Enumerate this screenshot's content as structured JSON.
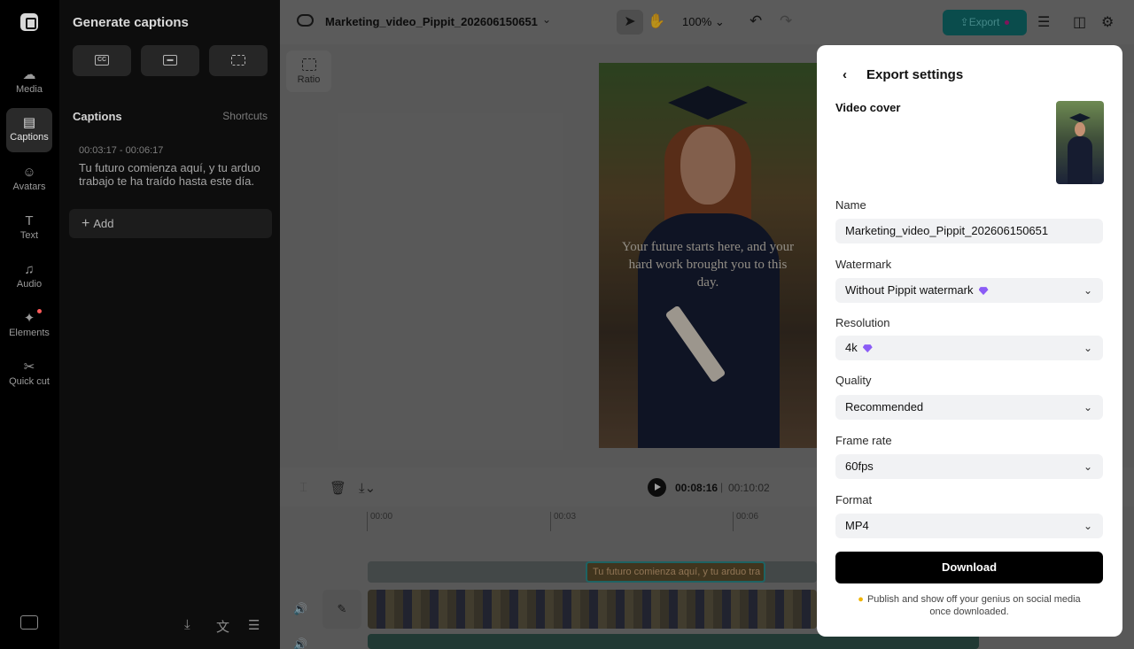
{
  "rail": {
    "items": [
      {
        "label": "Media",
        "icon": "cloud-upload-icon"
      },
      {
        "label": "Captions",
        "icon": "captions-icon"
      },
      {
        "label": "Avatars",
        "icon": "avatar-icon"
      },
      {
        "label": "Text",
        "icon": "text-icon"
      },
      {
        "label": "Audio",
        "icon": "music-icon"
      },
      {
        "label": "Elements",
        "icon": "elements-icon"
      },
      {
        "label": "Quick cut",
        "icon": "quick-cut-icon"
      }
    ],
    "active": "Captions"
  },
  "panel": {
    "title": "Generate captions",
    "captions_heading": "Captions",
    "shortcuts_label": "Shortcuts",
    "caption_time": "00:03:17 - 00:06:17",
    "caption_text": "Tu futuro comienza aquí, y tu arduo trabajo te ha traído hasta este día.",
    "add_label": "Add"
  },
  "topbar": {
    "project_title": "Marketing_video_Pippit_202606150651",
    "zoom": "100%",
    "export_label": "Export"
  },
  "canvas": {
    "ratio_label": "Ratio",
    "preview_text": "Your future starts here, and your hard work brought you to this day."
  },
  "timeline": {
    "current_time": "00:08:16",
    "separator": "|",
    "total_time": "00:10:02",
    "ticks": [
      "00:00",
      "00:03",
      "00:06"
    ],
    "caption_clip": "Tu futuro comienza aquí, y tu arduo tra"
  },
  "modal": {
    "title": "Export settings",
    "video_cover_label": "Video cover",
    "name_label": "Name",
    "name_value": "Marketing_video_Pippit_202606150651",
    "watermark_label": "Watermark",
    "watermark_value": "Without Pippit watermark",
    "resolution_label": "Resolution",
    "resolution_value": "4k",
    "quality_label": "Quality",
    "quality_value": "Recommended",
    "framerate_label": "Frame rate",
    "framerate_value": "60fps",
    "format_label": "Format",
    "format_value": "MP4",
    "download_label": "Download",
    "note": "Publish and show off your genius on social media once downloaded."
  },
  "colors": {
    "accent": "#0f6a6a",
    "premium": "#8b5cf6",
    "download_bg": "#000000"
  }
}
